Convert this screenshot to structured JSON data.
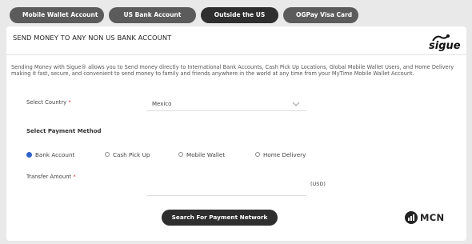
{
  "tabs": [
    {
      "label": "Mobile Wallet Account",
      "active": false
    },
    {
      "label": "US Bank Account",
      "active": false
    },
    {
      "label": "Outside the US",
      "active": true
    },
    {
      "label": "OGPay Visa Card",
      "active": false
    }
  ],
  "card": {
    "title": "SEND MONEY TO ANY NON US BANK ACCOUNT",
    "logo": {
      "word": "sigue",
      "icon": "sigue-logo-icon"
    },
    "description": "Sending Money with Sigue® allows you to Send money directly to International Bank Accounts, Cash Pick Up Locations, Global Mobile Wallet Users, and Home Delivery making it fast, secure, and convenient to send money to family and friends anywhere in the world at any time from your MyTime Mobile Wallet Account."
  },
  "form": {
    "country_label": "Select Country",
    "required_mark": "*",
    "country_value": "Mexico",
    "payment_method_heading": "Select Payment Method",
    "payment_methods": [
      {
        "label": "Bank Account",
        "selected": true
      },
      {
        "label": "Cash Pick Up",
        "selected": false
      },
      {
        "label": "Mobile Wallet",
        "selected": false
      },
      {
        "label": "Home Delivery",
        "selected": false
      }
    ],
    "amount_label": "Transfer Amount",
    "amount_value": "",
    "currency": "(USD)",
    "submit_label": "Search For Payment Network"
  },
  "footer_logo": {
    "text": "MCN",
    "icon": "mcn-logo-icon"
  },
  "colors": {
    "tab_bg": "#5b5b5b",
    "tab_active_bg": "#2e2e2e",
    "radio_selected": "#2f63c9",
    "required": "#dd4444",
    "page_bg": "#e9e9ea"
  }
}
